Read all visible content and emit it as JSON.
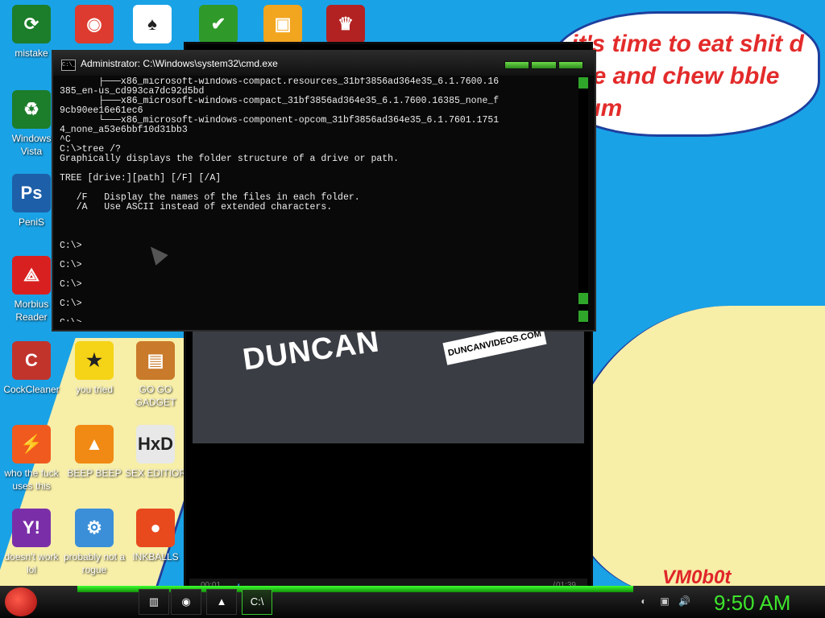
{
  "bubble": {
    "text": "it's time to eat shit d die and chew bble gum"
  },
  "watermark": "VM0b0t",
  "desktop_icons": [
    {
      "label": "mistake",
      "color": "#1c7d2a",
      "glyph": "⟳"
    },
    {
      "label": "",
      "color": "#dd3b2f",
      "glyph": "◉"
    },
    {
      "label": "",
      "color": "#ffffff",
      "glyph": "♠"
    },
    {
      "label": "",
      "color": "#2f9a2a",
      "glyph": "✔"
    },
    {
      "label": "",
      "color": "#f2a51e",
      "glyph": "▣"
    },
    {
      "label": "",
      "color": "#b32222",
      "glyph": "♛"
    },
    {
      "label": "Windows Vista",
      "color": "#1c7d2a",
      "glyph": "♻"
    },
    {
      "label": "PeniS",
      "color": "#1d5fa8",
      "glyph": "Ps"
    },
    {
      "label": "Morbius Reader",
      "color": "#d92020",
      "glyph": "⟁"
    },
    {
      "label": "CockCleaner",
      "color": "#c1342c",
      "glyph": "C"
    },
    {
      "label": "you tried",
      "color": "#f5d316",
      "glyph": "★"
    },
    {
      "label": "GO GO GADGET",
      "color": "#c97a2a",
      "glyph": "▤"
    },
    {
      "label": "who the fuck uses this",
      "color": "#f05a1e",
      "glyph": "⚡"
    },
    {
      "label": "BEEP BEEP",
      "color": "#f08a14",
      "glyph": "▲"
    },
    {
      "label": "SEX EDITIOR",
      "color": "#e8e8e8",
      "glyph": "HxD"
    },
    {
      "label": "doesn't work lol",
      "color": "#7a2fa8",
      "glyph": "Y!"
    },
    {
      "label": "probably not a rogue",
      "color": "#3a8fd8",
      "glyph": "⚙"
    },
    {
      "label": "INKBALLS",
      "color": "#e84a1e",
      "glyph": "●"
    }
  ],
  "player": {
    "video_text": "DUNCAN",
    "video_url_text": "DUNCANVIDEOS.COM",
    "time_elapsed": "00:01",
    "time_total": "01:39"
  },
  "cmd": {
    "title": "Administrator: C:\\Windows\\system32\\cmd.exe",
    "icon_label": "C:\\_",
    "lines": [
      "       ├───x86_microsoft-windows-compact.resources_31bf3856ad364e35_6.1.7600.16",
      "385_en-us_cd993ca7dc92d5bd",
      "       ├───x86_microsoft-windows-compact_31bf3856ad364e35_6.1.7600.16385_none_f",
      "9cb90ee16e61ec6",
      "       └───x86_microsoft-windows-component-opcom_31bf3856ad364e35_6.1.7601.1751",
      "4_none_a53e6bbf10d31bb3",
      "^C",
      "C:\\>tree /?",
      "Graphically displays the folder structure of a drive or path.",
      "",
      "TREE [drive:][path] [/F] [/A]",
      "",
      "   /F   Display the names of the files in each folder.",
      "   /A   Use ASCII instead of extended characters.",
      "",
      "",
      "",
      "C:\\>",
      "",
      "C:\\>",
      "",
      "C:\\>",
      "",
      "C:\\>",
      "",
      "C:\\>"
    ]
  },
  "taskbar": {
    "buttons": [
      {
        "name": "explorer",
        "glyph": "▥"
      },
      {
        "name": "chrome",
        "glyph": "◉"
      },
      {
        "name": "vlc",
        "glyph": "▲"
      },
      {
        "name": "cmd",
        "glyph": "C:\\"
      }
    ],
    "tray": [
      "◐",
      "▣",
      "🔊"
    ],
    "clock": "9:50 AM"
  }
}
